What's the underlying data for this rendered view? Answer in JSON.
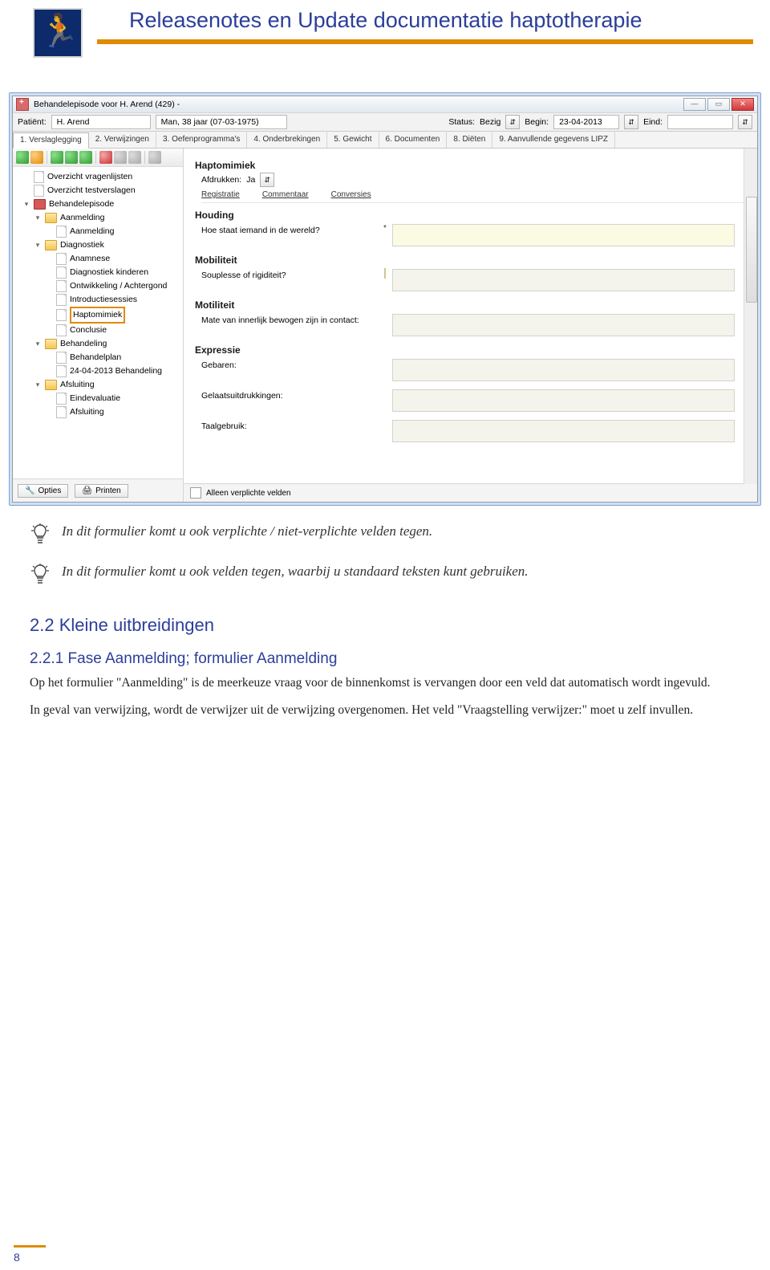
{
  "doc": {
    "title": "Releasenotes en Update documentatie haptotherapie",
    "page_number": "8"
  },
  "tips": [
    "In dit formulier komt u ook verplichte / niet-verplichte velden tegen.",
    "In dit formulier komt u ook velden tegen, waarbij u standaard teksten kunt gebruiken."
  ],
  "sections": {
    "h2": "2.2  Kleine uitbreidingen",
    "h3": "2.2.1  Fase Aanmelding; formulier Aanmelding",
    "p1": "Op het formulier \"Aanmelding\" is de meerkeuze vraag voor de binnenkomst is vervangen door een veld dat automatisch wordt ingevuld.",
    "p2": "In geval van verwijzing, wordt de verwijzer uit de verwijzing overgenomen. Het veld \"Vraagstelling verwijzer:\" moet u zelf invullen."
  },
  "window": {
    "title": "Behandelepisode voor H. Arend (429) -",
    "patient_label": "Patiënt:",
    "patient_name": "H. Arend",
    "person_info": "Man, 38 jaar (07-03-1975)",
    "status_label": "Status:",
    "status_value": "Bezig",
    "begin_label": "Begin:",
    "begin_value": "23-04-2013",
    "end_label": "Eind:",
    "end_value": "",
    "tabs": [
      "1. Verslaglegging",
      "2. Verwijzingen",
      "3. Oefenprogramma's",
      "4. Onderbrekingen",
      "5. Gewicht",
      "6. Documenten",
      "8. Diëten",
      "9. Aanvullende gegevens LIPZ"
    ],
    "tree": [
      {
        "level": 1,
        "type": "doc",
        "label": "Overzicht vragenlijsten"
      },
      {
        "level": 1,
        "type": "doc",
        "label": "Overzicht testverslagen"
      },
      {
        "level": 1,
        "type": "folder-red",
        "label": "Behandelepisode",
        "expanded": true
      },
      {
        "level": 2,
        "type": "folder",
        "label": "Aanmelding",
        "expanded": true
      },
      {
        "level": 3,
        "type": "doc",
        "label": "Aanmelding"
      },
      {
        "level": 2,
        "type": "folder",
        "label": "Diagnostiek",
        "expanded": true
      },
      {
        "level": 3,
        "type": "doc",
        "label": "Anamnese"
      },
      {
        "level": 3,
        "type": "doc",
        "label": "Diagnostiek kinderen"
      },
      {
        "level": 3,
        "type": "doc",
        "label": "Ontwikkeling / Achtergond"
      },
      {
        "level": 3,
        "type": "doc",
        "label": "Introductiesessies"
      },
      {
        "level": 3,
        "type": "doc",
        "label": "Haptomimiek",
        "highlight": true
      },
      {
        "level": 3,
        "type": "doc",
        "label": "Conclusie"
      },
      {
        "level": 2,
        "type": "folder",
        "label": "Behandeling",
        "expanded": true
      },
      {
        "level": 3,
        "type": "doc",
        "label": "Behandelplan"
      },
      {
        "level": 3,
        "type": "doc",
        "label": "24-04-2013 Behandeling"
      },
      {
        "level": 2,
        "type": "folder",
        "label": "Afsluiting",
        "expanded": true
      },
      {
        "level": 3,
        "type": "doc",
        "label": "Eindevaluatie"
      },
      {
        "level": 3,
        "type": "doc",
        "label": "Afsluiting"
      }
    ],
    "side_buttons": {
      "opties": "Opties",
      "printen": "Printen"
    },
    "content": {
      "title": "Haptomimiek",
      "afdrukken_label": "Afdrukken:",
      "afdrukken_value": "Ja",
      "links": [
        "Registratie",
        "Commentaar",
        "Conversies"
      ],
      "groups": [
        {
          "heading": "Houding",
          "fields": [
            {
              "label": "Hoe staat iemand in de wereld?",
              "required": true
            }
          ]
        },
        {
          "heading": "Mobiliteit",
          "fields": [
            {
              "label": "Souplesse of rigiditeit?",
              "icon": true
            }
          ]
        },
        {
          "heading": "Motiliteit",
          "fields": [
            {
              "label": "Mate van innerlijk bewogen zijn in contact:"
            }
          ]
        },
        {
          "heading": "Expressie",
          "fields": [
            {
              "label": "Gebaren:"
            },
            {
              "label": "Gelaatsuitdrukkingen:"
            },
            {
              "label": "Taalgebruik:"
            }
          ]
        }
      ],
      "only_required": "Alleen verplichte velden"
    }
  }
}
